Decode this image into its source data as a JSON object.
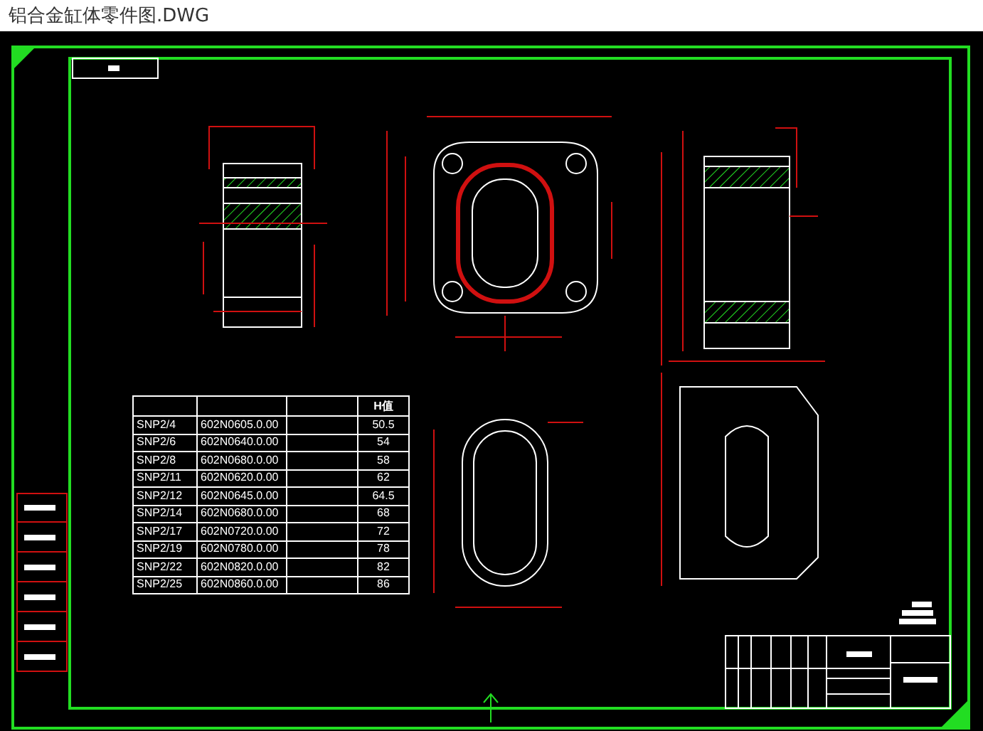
{
  "window": {
    "title": "铝合金缸体零件图.DWG"
  },
  "table": {
    "columns": [
      "H值"
    ],
    "rows": [
      {
        "model": "SNP2/4",
        "drawing_no": "602N0605.0.00",
        "h": "50.5"
      },
      {
        "model": "SNP2/6",
        "drawing_no": "602N0640.0.00",
        "h": "54"
      },
      {
        "model": "SNP2/8",
        "drawing_no": "602N0680.0.00",
        "h": "58"
      },
      {
        "model": "SNP2/11",
        "drawing_no": "602N0620.0.00",
        "h": "62"
      },
      {
        "model": "SNP2/12",
        "drawing_no": "602N0645.0.00",
        "h": "64.5"
      },
      {
        "model": "SNP2/14",
        "drawing_no": "602N0680.0.00",
        "h": "68"
      },
      {
        "model": "SNP2/17",
        "drawing_no": "602N0720.0.00",
        "h": "72"
      },
      {
        "model": "SNP2/19",
        "drawing_no": "602N0780.0.00",
        "h": "78"
      },
      {
        "model": "SNP2/22",
        "drawing_no": "602N0820.0.00",
        "h": "82"
      },
      {
        "model": "SNP2/25",
        "drawing_no": "602N0860.0.00",
        "h": "86"
      }
    ]
  }
}
